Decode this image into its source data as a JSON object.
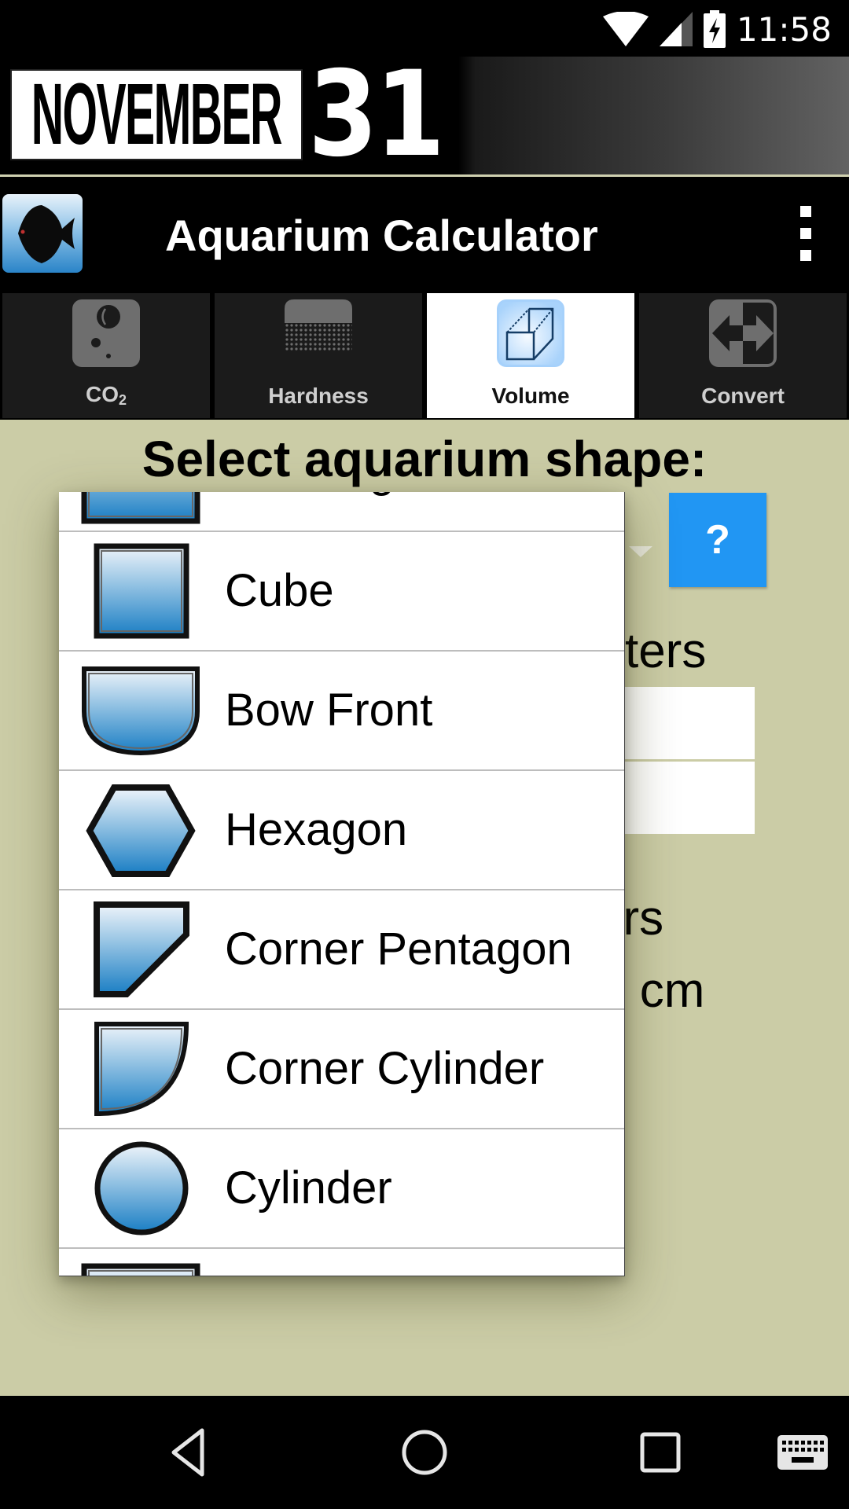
{
  "status_bar": {
    "time": "11:58",
    "icons": [
      "wifi-icon",
      "cell-signal-icon",
      "battery-charging-icon"
    ]
  },
  "banner": {
    "logo_word": "NOVEMBER",
    "logo_number": "31"
  },
  "app_bar": {
    "title": "Aquarium Calculator",
    "app_icon": "fish-icon",
    "menu_icon": "more-vert-icon"
  },
  "tabs": [
    {
      "label": "CO",
      "subscript": "2",
      "icon": "co2-bubbles-icon",
      "active": false
    },
    {
      "label": "Hardness",
      "subscript": "",
      "icon": "hardness-dots-icon",
      "active": false
    },
    {
      "label": "Volume",
      "subscript": "",
      "icon": "cube-icon",
      "active": true
    },
    {
      "label": "Convert",
      "subscript": "",
      "icon": "convert-arrows-icon",
      "active": false
    }
  ],
  "content": {
    "section_title": "Select aquarium shape:",
    "help_button": "?",
    "background_fragments": {
      "units_label": "neters",
      "result_label_1": "ers",
      "result_label_2": "q cm"
    }
  },
  "shape_dropdown": {
    "options": [
      {
        "label": "Rectangle",
        "icon": "rectangle-shape-icon",
        "partially_visible": true
      },
      {
        "label": "Cube",
        "icon": "cube-shape-icon"
      },
      {
        "label": "Bow Front",
        "icon": "bow-front-shape-icon"
      },
      {
        "label": "Hexagon",
        "icon": "hexagon-shape-icon"
      },
      {
        "label": "Corner Pentagon",
        "icon": "corner-pentagon-shape-icon"
      },
      {
        "label": "Corner Cylinder",
        "icon": "corner-cylinder-shape-icon"
      },
      {
        "label": "Cylinder",
        "icon": "cylinder-shape-icon"
      },
      {
        "label": "",
        "icon": "rectangle-shape-icon",
        "partially_visible": true
      }
    ]
  },
  "nav_bar": {
    "buttons": [
      "back-icon",
      "home-icon",
      "recents-icon",
      "keyboard-icon"
    ]
  },
  "colors": {
    "content_background": "#cbcca6",
    "help_button": "#2196f3",
    "active_tab": "#ffffff",
    "inactive_tab": "#1b1b1b",
    "shape_fill_top": "#eef4fa",
    "shape_fill_bottom": "#1a7ec4"
  }
}
